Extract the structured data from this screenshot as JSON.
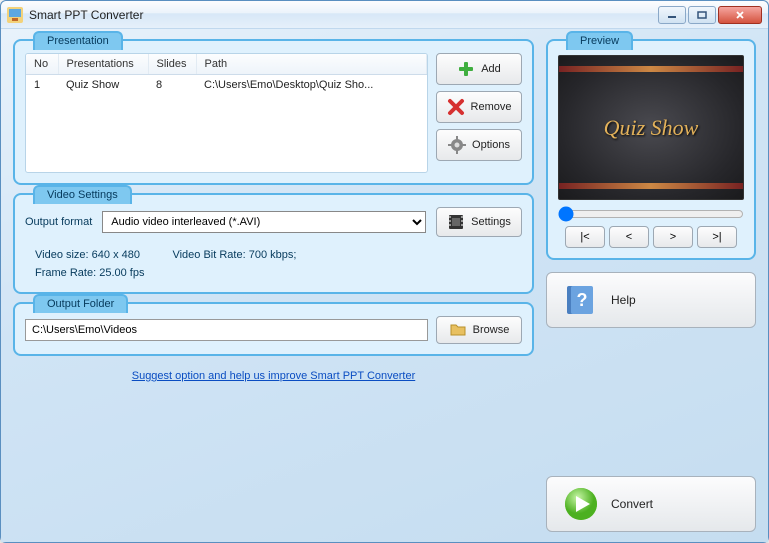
{
  "window": {
    "title": "Smart PPT Converter"
  },
  "presentation": {
    "title": "Presentation",
    "headers": {
      "no": "No",
      "name": "Presentations",
      "slides": "Slides",
      "path": "Path"
    },
    "rows": [
      {
        "no": "1",
        "name": "Quiz Show",
        "slides": "8",
        "path": "C:\\Users\\Emo\\Desktop\\Quiz Sho..."
      }
    ],
    "add": "Add",
    "remove": "Remove",
    "options": "Options"
  },
  "video": {
    "title": "Video Settings",
    "format_label": "Output format",
    "format_value": "Audio video interleaved (*.AVI)",
    "settings": "Settings",
    "size_label": "Video size:",
    "size_value": "640 x 480",
    "bitrate_label": "Video Bit Rate:",
    "bitrate_value": "700 kbps;",
    "framerate_label": "Frame Rate:",
    "framerate_value": "25.00 fps"
  },
  "output": {
    "title": "Output Folder",
    "path": "C:\\Users\\Emo\\Videos",
    "browse": "Browse"
  },
  "suggest": "Suggest option and help us improve Smart PPT Converter",
  "preview": {
    "title": "Preview",
    "slide_title": "Quiz Show"
  },
  "nav": {
    "first": "|<",
    "prev": "<",
    "next": ">",
    "last": ">|"
  },
  "help": "Help",
  "convert": "Convert"
}
